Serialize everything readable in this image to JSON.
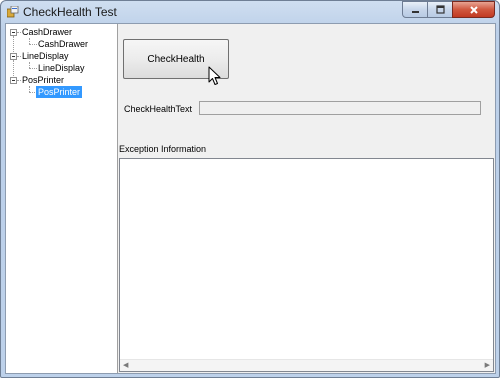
{
  "window": {
    "title": "CheckHealth Test"
  },
  "icons": {
    "app": "app-icon",
    "minimize": "minimize-icon",
    "maximize": "maximize-icon",
    "close": "close-icon"
  },
  "tree": {
    "nodes": [
      {
        "label": "CashDrawer",
        "children": [
          "CashDrawer"
        ]
      },
      {
        "label": "LineDisplay",
        "children": [
          "LineDisplay"
        ]
      },
      {
        "label": "PosPrinter",
        "children": [
          "PosPrinter"
        ]
      }
    ],
    "selected": "PosPrinter"
  },
  "main": {
    "check_button_label": "CheckHealth",
    "checkhealth_text_label": "CheckHealthText",
    "checkhealth_text_value": "",
    "exception_label": "Exception Information",
    "exception_text": ""
  },
  "colors": {
    "selection": "#3399ff",
    "close_button": "#c13a22"
  }
}
